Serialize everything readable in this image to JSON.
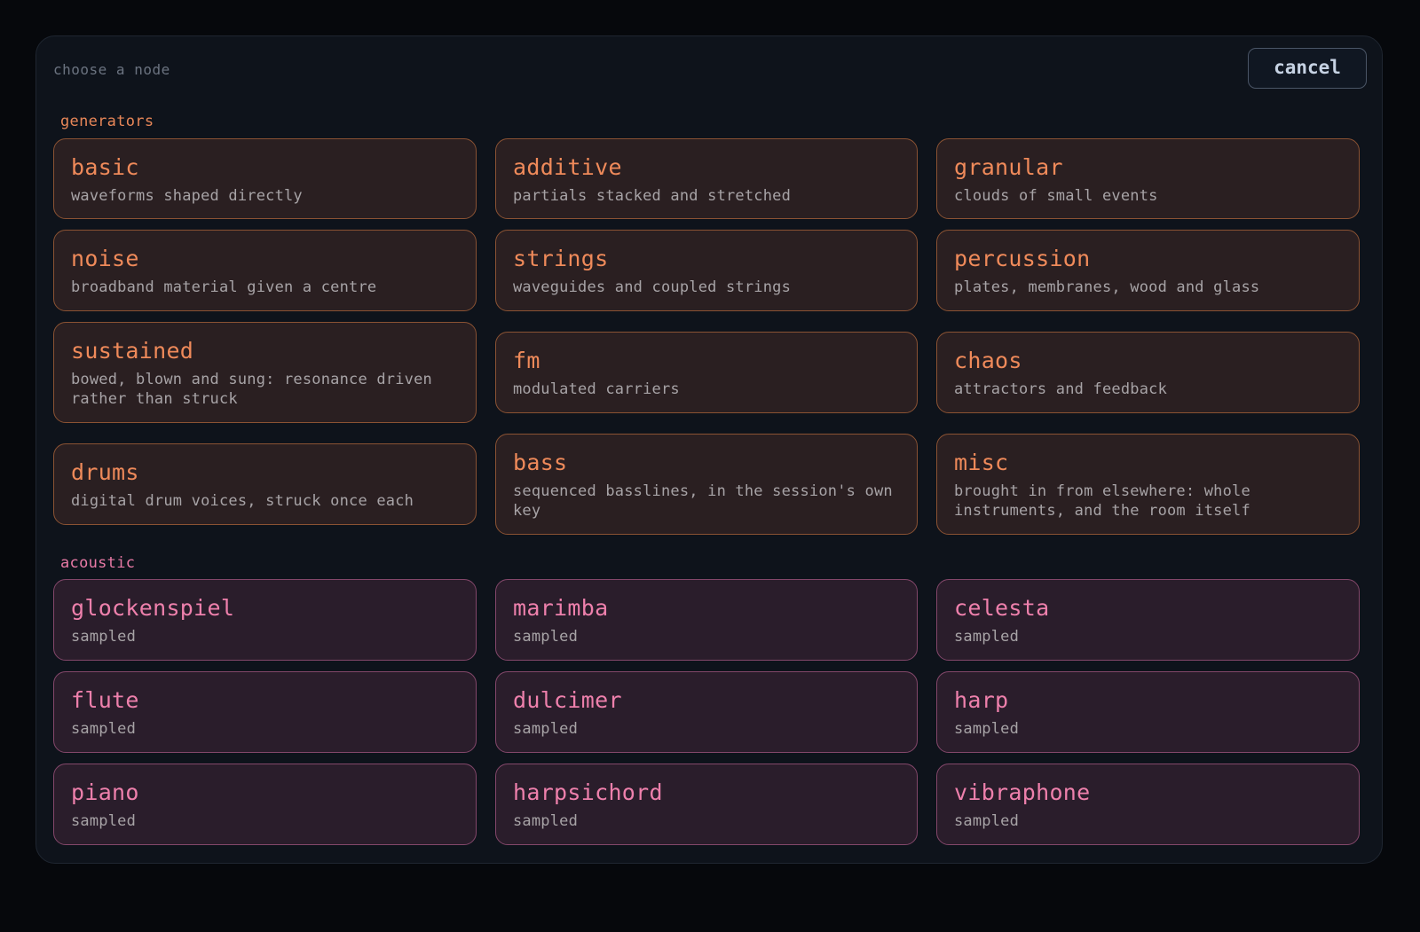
{
  "dialog": {
    "title": "choose a node",
    "cancel_label": "cancel"
  },
  "sections": {
    "generators": {
      "label": "generators",
      "items": [
        {
          "name": "basic",
          "desc": "waveforms shaped directly"
        },
        {
          "name": "additive",
          "desc": "partials stacked and stretched"
        },
        {
          "name": "granular",
          "desc": "clouds of small events"
        },
        {
          "name": "noise",
          "desc": "broadband material given a centre"
        },
        {
          "name": "strings",
          "desc": "waveguides and coupled strings"
        },
        {
          "name": "percussion",
          "desc": "plates, membranes, wood and glass"
        },
        {
          "name": "sustained",
          "desc": "bowed, blown and sung: resonance driven rather than struck"
        },
        {
          "name": "fm",
          "desc": "modulated carriers"
        },
        {
          "name": "chaos",
          "desc": "attractors and feedback"
        },
        {
          "name": "drums",
          "desc": "digital drum voices, struck once each"
        },
        {
          "name": "bass",
          "desc": "sequenced basslines, in the session's own key"
        },
        {
          "name": "misc",
          "desc": "brought in from elsewhere: whole instruments, and the room itself"
        }
      ]
    },
    "acoustic": {
      "label": "acoustic",
      "items": [
        {
          "name": "glockenspiel",
          "desc": "sampled"
        },
        {
          "name": "marimba",
          "desc": "sampled"
        },
        {
          "name": "celesta",
          "desc": "sampled"
        },
        {
          "name": "flute",
          "desc": "sampled"
        },
        {
          "name": "dulcimer",
          "desc": "sampled"
        },
        {
          "name": "harp",
          "desc": "sampled"
        },
        {
          "name": "piano",
          "desc": "sampled"
        },
        {
          "name": "harpsichord",
          "desc": "sampled"
        },
        {
          "name": "vibraphone",
          "desc": "sampled"
        }
      ]
    }
  },
  "colors": {
    "generators_accent": "#ef8a5a",
    "acoustic_accent": "#ee80ac",
    "modal_bg": "#0e131b"
  }
}
